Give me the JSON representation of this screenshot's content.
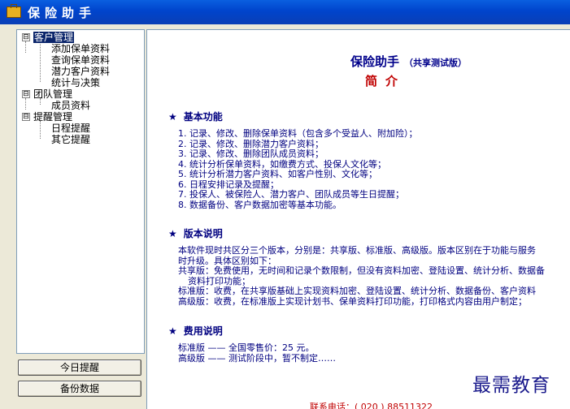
{
  "window": {
    "title": "保险助手"
  },
  "sidebar": {
    "groups": [
      {
        "label": "客户管理",
        "expander": "⊟",
        "children": [
          "添加保单资料",
          "查询保单资料",
          "潜力客户资料",
          "统计与决策"
        ]
      },
      {
        "label": "团队管理",
        "expander": "⊟",
        "children": [
          "成员资料"
        ]
      },
      {
        "label": "提醒管理",
        "expander": "⊟",
        "children": [
          "日程提醒",
          "其它提醒"
        ]
      }
    ],
    "buttons": {
      "today_reminder": "今日提醒",
      "backup": "备份数据"
    }
  },
  "content": {
    "heading": "保险助手",
    "heading_sub": "（共享测试版）",
    "subtitle": "简介",
    "features_title": "基本功能",
    "features": [
      "1.  记录、修改、删除保单资料（包含多个受益人、附加险）；",
      "2.  记录、修改、删除潜力客户资料；",
      "3.  记录、修改、删除团队成员资料；",
      "4.  统计分析保单资料，如缴费方式、投保人文化等；",
      "5.  统计分析潜力客户资料、如客户性别、文化等；",
      "6.  日程安排记录及提醒；",
      "7.  投保人、被保险人、潜力客户、团队成员等生日提醒；",
      "8.  数据备份、客户数据加密等基本功能。"
    ],
    "version_title": "版本说明",
    "version_lines": [
      "本软件现时共区分三个版本，分别是：共享版、标准版、高级版。版本区别在于功能与服务",
      "时升级。具体区别如下：",
      "共享版：免费使用，无时间和记录个数限制，但没有资料加密、登陆设置、统计分析、数据备",
      "资料打印功能；",
      "标准版：收费，在共享版基础上实现资料加密、登陆设置、统计分析、数据备份、客户资料",
      "高级版：收费，在标准版上实现计划书、保单资料打印功能，打印格式内容由用户制定；"
    ],
    "fee_title": "费用说明",
    "fee_lines": [
      "标准版 —— 全国零售价：25 元。",
      "高级版 —— 测试阶段中，暂不制定……"
    ],
    "contact": "联系电话：( 020 ) 88511322",
    "watermark": "最需教育",
    "star_glyph": "★"
  }
}
